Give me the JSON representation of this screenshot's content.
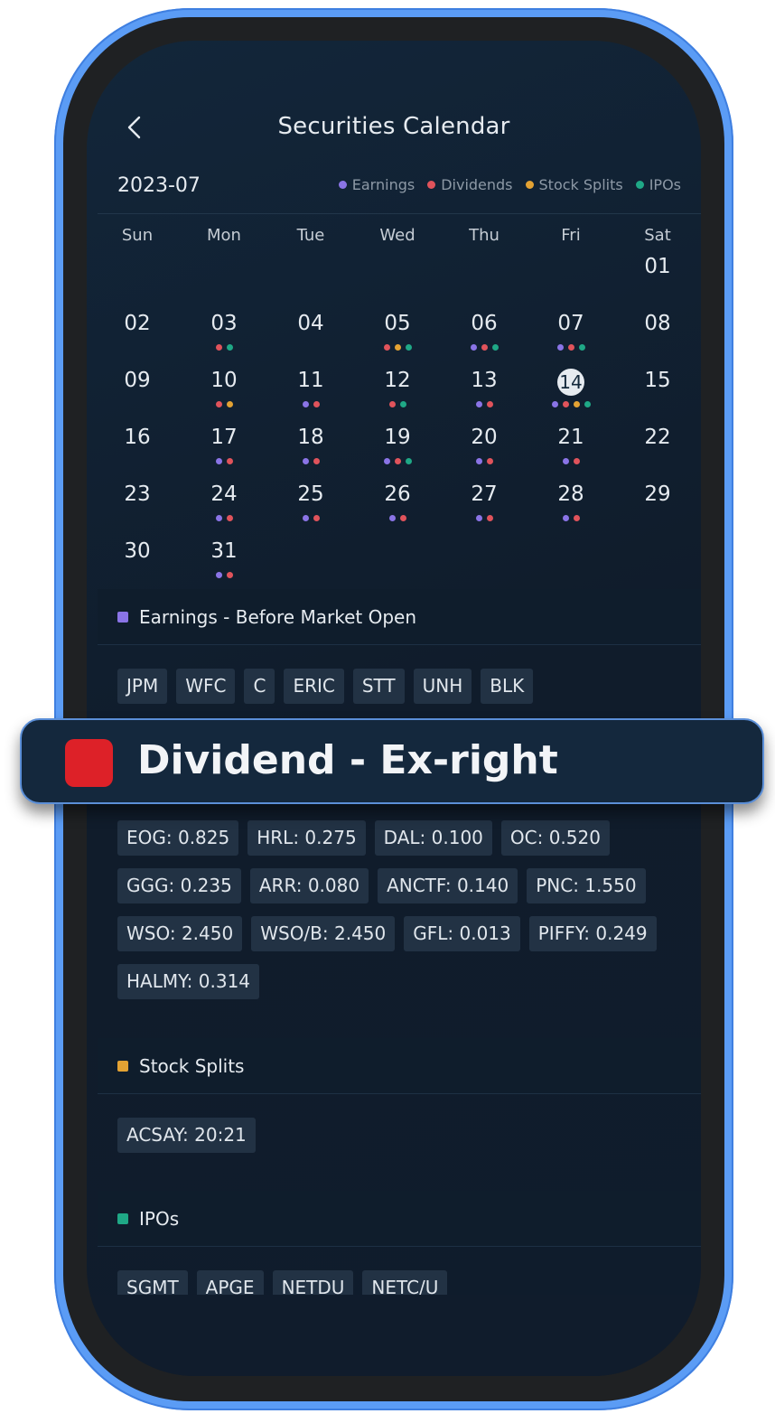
{
  "header": {
    "title": "Securities Calendar"
  },
  "calendar": {
    "month": "2023-07",
    "legend": [
      {
        "label": "Earnings",
        "color": "#8a74e6"
      },
      {
        "label": "Dividends",
        "color": "#e0535b"
      },
      {
        "label": "Stock Splits",
        "color": "#e3a233"
      },
      {
        "label": "IPOs",
        "color": "#1fa886"
      }
    ],
    "weekdays": [
      "Sun",
      "Mon",
      "Tue",
      "Wed",
      "Thu",
      "Fri",
      "Sat"
    ],
    "weeks": [
      [
        "",
        "",
        "",
        "",
        "",
        "",
        "01"
      ],
      [
        "02",
        "03",
        "04",
        "05",
        "06",
        "07",
        "08"
      ],
      [
        "09",
        "10",
        "11",
        "12",
        "13",
        "14",
        "15"
      ],
      [
        "16",
        "17",
        "18",
        "19",
        "20",
        "21",
        "22"
      ],
      [
        "23",
        "24",
        "25",
        "26",
        "27",
        "28",
        "29"
      ],
      [
        "30",
        "31",
        "",
        "",
        "",
        "",
        ""
      ]
    ],
    "selected_day": "14",
    "event_dots": {
      "03": [
        "Dividends",
        "IPOs"
      ],
      "05": [
        "Dividends",
        "Stock Splits",
        "IPOs"
      ],
      "06": [
        "Earnings",
        "Dividends",
        "IPOs"
      ],
      "07": [
        "Earnings",
        "Dividends",
        "IPOs"
      ],
      "10": [
        "Dividends",
        "Stock Splits"
      ],
      "11": [
        "Earnings",
        "Dividends"
      ],
      "12": [
        "Dividends",
        "IPOs"
      ],
      "13": [
        "Earnings",
        "Dividends"
      ],
      "14": [
        "Earnings",
        "Dividends",
        "Stock Splits",
        "IPOs"
      ],
      "17": [
        "Earnings",
        "Dividends"
      ],
      "18": [
        "Earnings",
        "Dividends"
      ],
      "19": [
        "Earnings",
        "Dividends",
        "IPOs"
      ],
      "20": [
        "Earnings",
        "Dividends"
      ],
      "21": [
        "Earnings",
        "Dividends"
      ],
      "24": [
        "Earnings",
        "Dividends"
      ],
      "25": [
        "Earnings",
        "Dividends"
      ],
      "26": [
        "Earnings",
        "Dividends"
      ],
      "27": [
        "Earnings",
        "Dividends"
      ],
      "28": [
        "Earnings",
        "Dividends"
      ],
      "31": [
        "Earnings",
        "Dividends"
      ]
    }
  },
  "sections": {
    "earnings": {
      "label": "Earnings - Before Market Open",
      "color": "#8a74e6",
      "chips": [
        "JPM",
        "WFC",
        "C",
        "ERIC",
        "STT",
        "UNH",
        "BLK"
      ]
    },
    "dividends": {
      "chips": [
        "EOG: 0.825",
        "HRL: 0.275",
        "DAL: 0.100",
        "OC: 0.520",
        "GGG: 0.235",
        "ARR: 0.080",
        "ANCTF: 0.140",
        "PNC: 1.550",
        "WSO: 2.450",
        "WSO/B: 2.450",
        "GFL: 0.013",
        "PIFFY: 0.249",
        "HALMY: 0.314"
      ]
    },
    "splits": {
      "label": "Stock Splits",
      "color": "#e3a233",
      "chips": [
        "ACSAY: 20:21"
      ]
    },
    "ipos": {
      "label": "IPOs",
      "color": "#1fa886",
      "chips": [
        "SGMT",
        "APGE",
        "NETDU",
        "NETC/U"
      ]
    }
  },
  "banner": {
    "label": "Dividend - Ex-right",
    "color": "#dd2128"
  }
}
